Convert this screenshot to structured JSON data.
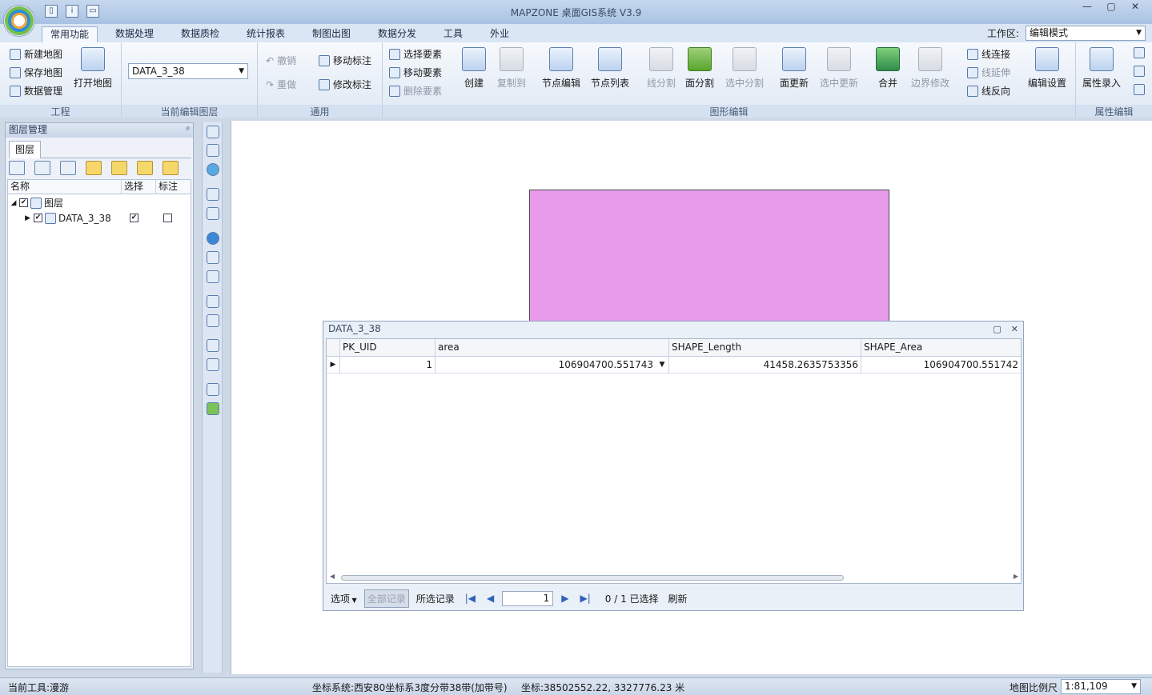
{
  "window": {
    "title": "MAPZONE 桌面GIS系统 V3.9",
    "min": "—",
    "max": "▢",
    "close": "✕"
  },
  "quick_access": [
    "▯",
    "i",
    "▭"
  ],
  "menu_tabs": [
    "常用功能",
    "数据处理",
    "数据质检",
    "统计报表",
    "制图出图",
    "数据分发",
    "工具",
    "外业"
  ],
  "workspace": {
    "label": "工作区:",
    "value": "编辑模式"
  },
  "ribbon": {
    "project": {
      "new_map": "新建地图",
      "save_map": "保存地图",
      "data_manage": "数据管理",
      "open_map": "打开地图",
      "label": "工程"
    },
    "current_layer": {
      "value": "DATA_3_38",
      "label": "当前编辑图层"
    },
    "common": {
      "undo": "撤销",
      "redo": "重做",
      "move_label": "移动标注",
      "edit_label": "修改标注",
      "label": "通用"
    },
    "shape_edit": {
      "select_feature": "选择要素",
      "move_feature": "移动要素",
      "delete_feature": "删除要素",
      "create": "创建",
      "copy_to": "复制到",
      "node_edit": "节点编辑",
      "node_list": "节点列表",
      "line_split": "线分割",
      "polygon_split": "面分割",
      "selected_split": "选中分割",
      "polygon_update": "面更新",
      "selected_update": "选中更新",
      "merge": "合并",
      "boundary_edit": "边界修改",
      "line_connect": "线连接",
      "line_extend": "线延伸",
      "line_reverse": "线反向",
      "label": "图形编辑"
    },
    "attr_edit": {
      "edit_settings": "编辑设置",
      "attr_input": "属性录入",
      "label": "属性编辑"
    }
  },
  "layer_panel": {
    "title": "图层管理",
    "pin": "ᵖ",
    "tab": "图层",
    "columns": [
      "名称",
      "选择",
      "标注"
    ],
    "root": "图层",
    "layer": "DATA_3_38"
  },
  "attribute_table": {
    "title": "DATA_3_38",
    "columns": [
      "PK_UID",
      "area",
      "SHAPE_Length",
      "SHAPE_Area"
    ],
    "rows": [
      [
        "1",
        "106904700.551743",
        "41458.2635753356",
        "106904700.551742"
      ]
    ],
    "options": "选项",
    "all_records": "全部记录",
    "selected_records": "所选记录",
    "page": "1",
    "selection_status": "0 / 1 已选择",
    "refresh": "刷新"
  },
  "status_bar": {
    "current_tool": "当前工具:漫游",
    "coord_system": "坐标系统:西安80坐标系3度分带38带(加带号)",
    "coords": "坐标:38502552.22, 3327776.23 米",
    "scale_label": "地图比例尺",
    "scale_value": "1:81,109"
  },
  "colors": {
    "polygon_fill": "#e89bea",
    "ribbon_bg": "#dfe8f4"
  }
}
